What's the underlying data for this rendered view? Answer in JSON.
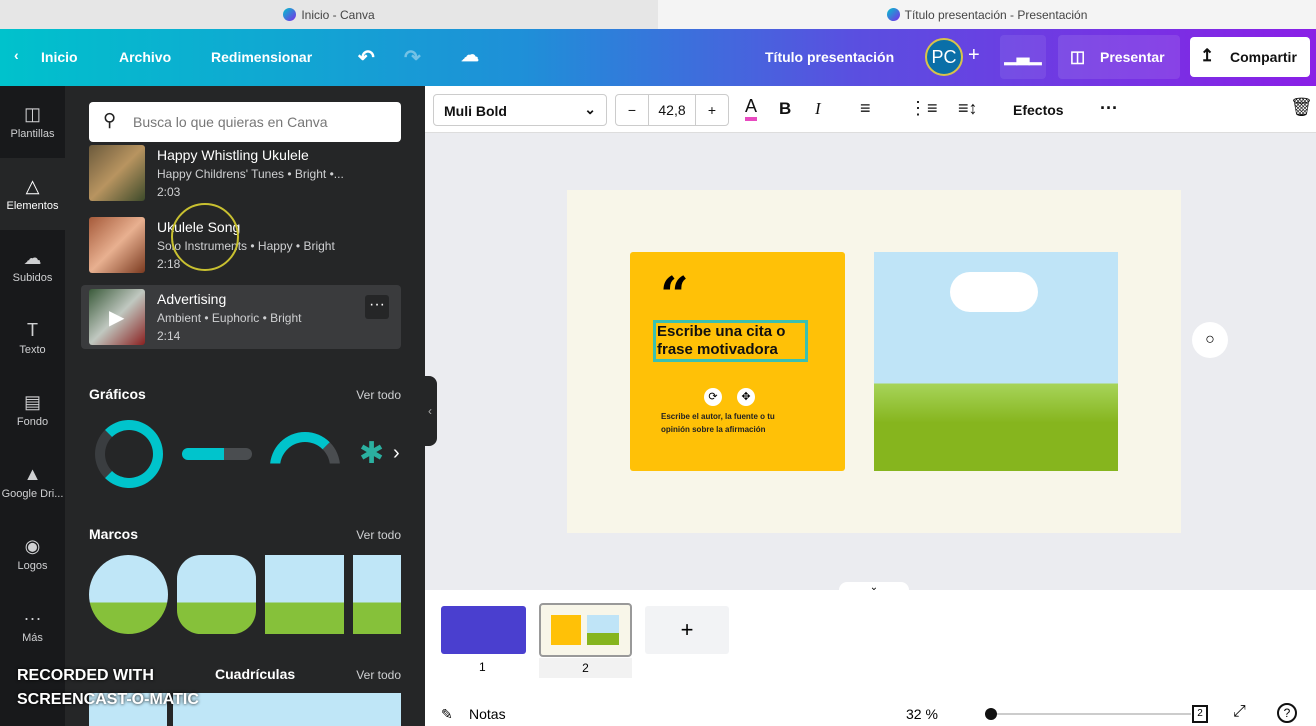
{
  "window": {
    "left_title": "Inicio - Canva",
    "right_title": "Título presentación - Presentación"
  },
  "header": {
    "back": "Inicio",
    "file": "Archivo",
    "resize": "Redimensionar",
    "doc_title": "Título presentación",
    "avatar": "PC",
    "present": "Presentar",
    "share": "Compartir"
  },
  "rail": [
    {
      "label": "Plantillas",
      "icon": "template-icon"
    },
    {
      "label": "Elementos",
      "icon": "elements-icon"
    },
    {
      "label": "Subidos",
      "icon": "upload-icon"
    },
    {
      "label": "Texto",
      "icon": "text-icon"
    },
    {
      "label": "Fondo",
      "icon": "background-icon"
    },
    {
      "label": "Google Dri...",
      "icon": "google-drive-icon"
    },
    {
      "label": "Logos",
      "icon": "logo-icon"
    },
    {
      "label": "Más",
      "icon": "more-icon"
    }
  ],
  "panel": {
    "search_placeholder": "Busca lo que quieras en Canva",
    "audio": [
      {
        "title": "Happy Whistling Ukulele",
        "tags": "Happy Childrens' Tunes • Bright •...",
        "duration": "2:03"
      },
      {
        "title": "Ukulele Song",
        "tags": "Solo Instruments • Happy • Bright",
        "duration": "2:18"
      },
      {
        "title": "Advertising",
        "tags": "Ambient • Euphoric • Bright",
        "duration": "2:14"
      }
    ],
    "graphics": "Gráficos",
    "frames": "Marcos",
    "grids": "Cuadrículas",
    "see_all": "Ver todo"
  },
  "toolbar": {
    "font": "Muli Bold",
    "font_size": "42,8",
    "effects": "Efectos"
  },
  "slide": {
    "quote": "Escribe una cita o frase motivadora",
    "author": "Escribe el autor, la fuente o tu opinión sobre la afirmación"
  },
  "pages": [
    "1",
    "2"
  ],
  "footer": {
    "notes": "Notas",
    "zoom": "32 %",
    "page_count": "2",
    "zoom_fraction": 0.0
  },
  "watermark": "RECORDED WITH SCREENCAST-O-MATIC",
  "colors": {
    "accent_teal": "#00c4cc",
    "accent_purple": "#7d2ae8",
    "card_yellow": "#ffc107"
  }
}
